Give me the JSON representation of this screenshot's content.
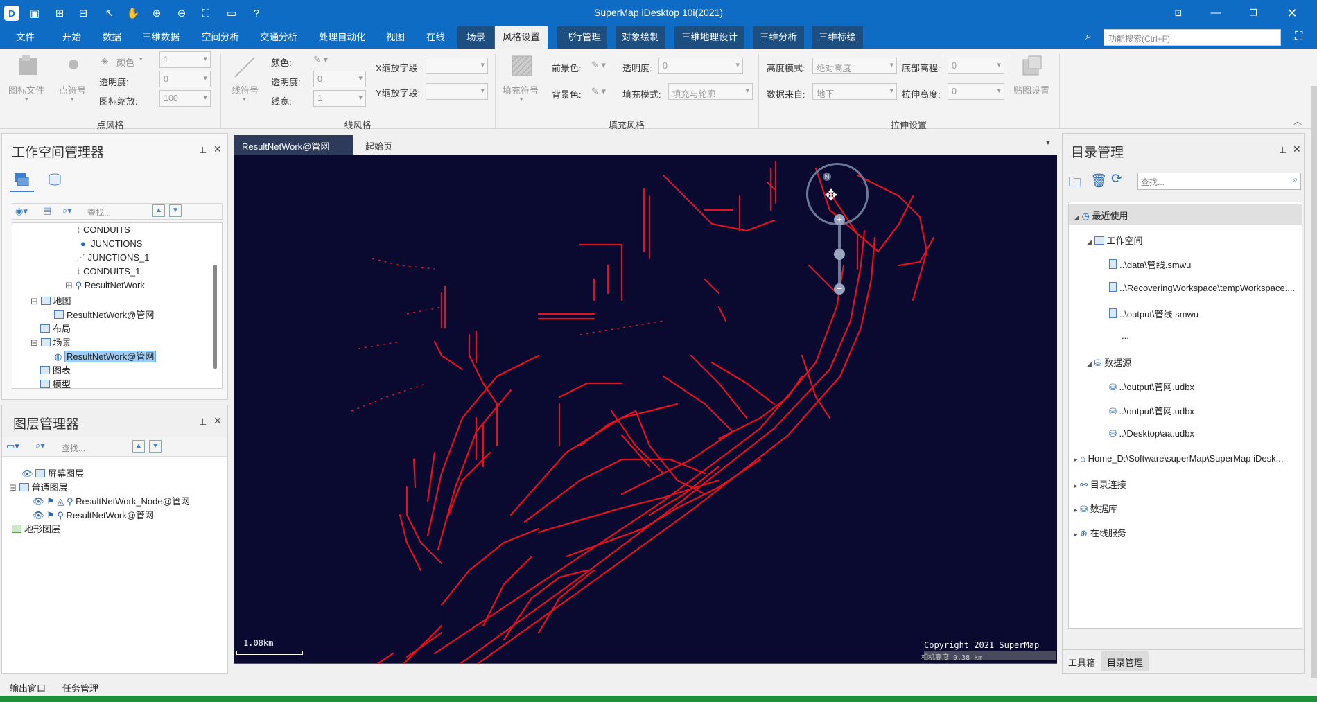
{
  "app": {
    "title": "SuperMap iDesktop 10i(2021)"
  },
  "menus": [
    "文件",
    "开始",
    "数据",
    "三维数据",
    "空间分析",
    "交通分析",
    "处理自动化",
    "视图",
    "在线",
    "场景",
    "风格设置",
    "飞行管理",
    "对象绘制",
    "三维地理设计",
    "三维分析",
    "三维标绘"
  ],
  "active_menu": "风格设置",
  "search": {
    "placeholder": "功能搜索(Ctrl+F)"
  },
  "ribbon": {
    "point": {
      "icon_file": "图标文件",
      "point_symbol": "点符号",
      "color": "颜色",
      "opacity": "透明度:",
      "scale": "图标缩放:",
      "v1": "1",
      "v2": "0",
      "v3": "100",
      "group": "点风格"
    },
    "line": {
      "symbol": "线符号",
      "color": "颜色:",
      "opacity": "透明度:",
      "width": "线宽:",
      "x_field": "X缩放字段:",
      "y_field": "Y缩放字段:",
      "v2": "0",
      "v3": "1",
      "group": "线风格"
    },
    "fill": {
      "symbol": "填充符号",
      "fg": "前景色:",
      "bg": "背景色:",
      "opacity": "透明度:",
      "opacity_value": "0",
      "mode": "填充模式:",
      "mode_value": "填充与轮廓",
      "group": "填充风格"
    },
    "extrude": {
      "height_mode": "高度模式:",
      "height_mode_value": "绝对高度",
      "source": "数据来自:",
      "source_value": "地下",
      "bottom": "底部高程:",
      "bottom_value": "0",
      "extrude_height": "拉伸高度:",
      "extrude_value": "0",
      "texture": "贴图设置",
      "group": "拉伸设置"
    }
  },
  "workspace": {
    "title": "工作空间管理器",
    "search_placeholder": "查找...",
    "items": [
      "CONDUITS",
      "JUNCTIONS",
      "JUNCTIONS_1",
      "CONDUITS_1",
      "ResultNetWork",
      "地图",
      "ResultNetWork@管网",
      "布局",
      "场景",
      "ResultNetWork@管网",
      "图表",
      "模型"
    ]
  },
  "layers": {
    "title": "图层管理器",
    "search_placeholder": "查找...",
    "items": [
      "屏幕图层",
      "普通图层",
      "ResultNetWork_Node@管网",
      "ResultNetWork@管网",
      "地形图层"
    ]
  },
  "tabs": [
    "ResultNetWork@管网",
    "起始页"
  ],
  "map": {
    "scale": "1.08km",
    "copyright": "Copyright 2021 SuperMap",
    "camera": "相机高度 9.38 km",
    "compass": "N"
  },
  "catalog": {
    "title": "目录管理",
    "search_placeholder": "查找...",
    "items": [
      "最近使用",
      "工作空间",
      "..\\data\\管线.smwu",
      "..\\RecoveringWorkspace\\tempWorkspace....",
      "..\\output\\管线.smwu",
      "...",
      "数据源",
      "..\\output\\管网.udbx",
      "..\\output\\管网.udbx",
      "..\\Desktop\\aa.udbx",
      "Home_D:\\Software\\superMap\\SuperMap iDesk...",
      "目录连接",
      "数据库",
      "在线服务"
    ],
    "bottom_tabs": [
      "工具箱",
      "目录管理"
    ]
  },
  "status": {
    "items": [
      "输出窗口",
      "任务管理"
    ]
  },
  "colors": {
    "title_bar": "#0f6cc4",
    "map_bg": "#0a0a30",
    "network": "#e8101c"
  }
}
